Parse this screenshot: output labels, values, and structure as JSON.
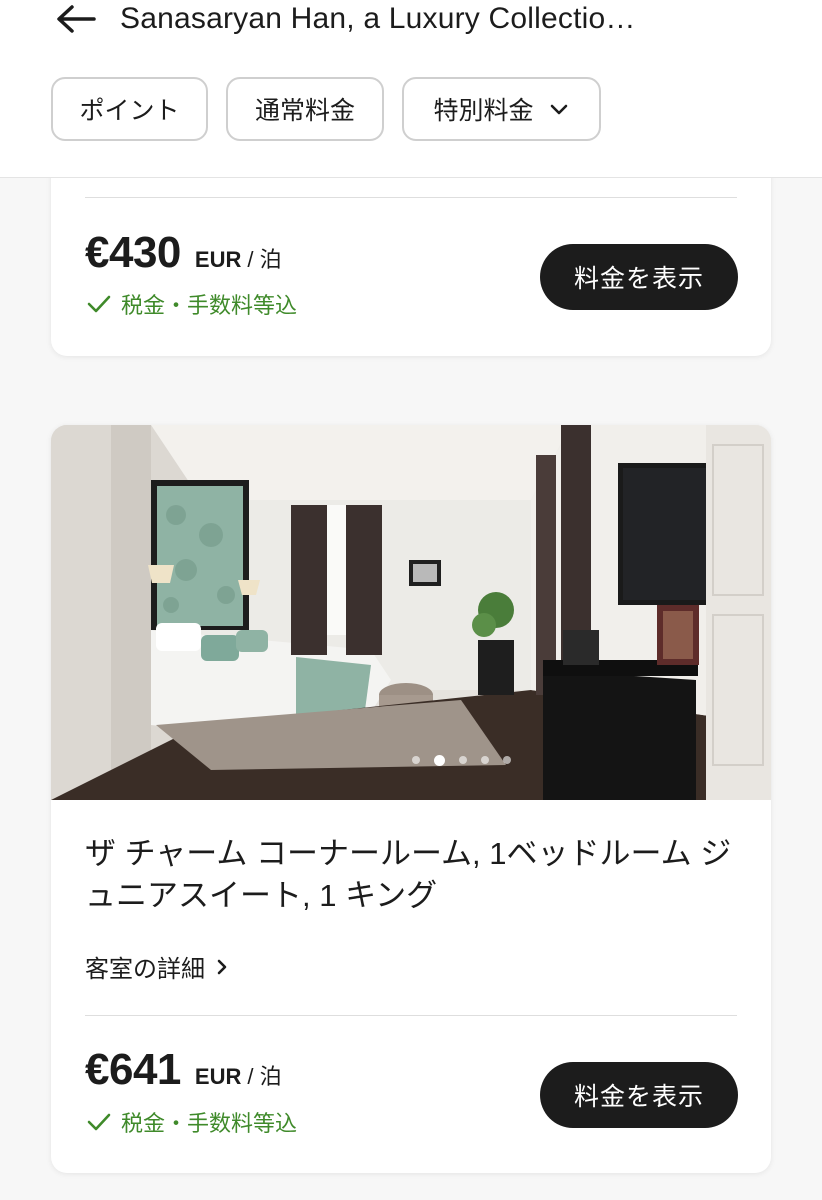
{
  "header": {
    "title": "Sanasaryan Han, a Luxury Collectio…",
    "back_icon": "arrow-left-icon"
  },
  "filters": {
    "points": "ポイント",
    "regular": "通常料金",
    "special": "特別料金"
  },
  "cards": [
    {
      "price": "€430",
      "currency": "EUR",
      "per_night": "/ 泊",
      "tax_note": "税金・手数料等込",
      "button": "料金を表示"
    },
    {
      "room_name": "ザ チャーム コーナールーム, 1ベッドルーム ジュニアスイート, 1 キング",
      "details_link": "客室の詳細",
      "carousel": {
        "total": 5,
        "current": 2
      },
      "price": "€641",
      "currency": "EUR",
      "per_night": "/ 泊",
      "tax_note": "税金・手数料等込",
      "button": "料金を表示"
    }
  ],
  "colors": {
    "accent_green": "#3f8a2a",
    "button_dark": "#1c1c1c"
  }
}
